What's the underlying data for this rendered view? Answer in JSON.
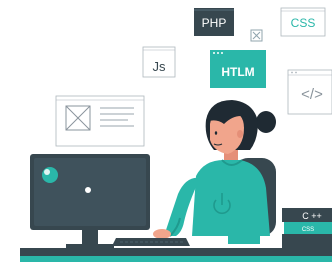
{
  "colors": {
    "accent": "#2ab7a9",
    "accent_dark": "#1f9a8e",
    "dark": "#37474f",
    "hair": "#1f2a33",
    "skin": "#f1a58c",
    "line": "#b8c0c8",
    "card_fill": "#ffffff"
  },
  "cards": {
    "php": "PHP",
    "css": "CSS",
    "js": "Js",
    "htlm": "HTLM",
    "code_brackets": "</>",
    "cpp": "C ++",
    "css_small": "CSS"
  },
  "icons": {
    "image_placeholder": "image-placeholder-icon",
    "close_small": "close-small-icon",
    "power": "power-icon"
  }
}
